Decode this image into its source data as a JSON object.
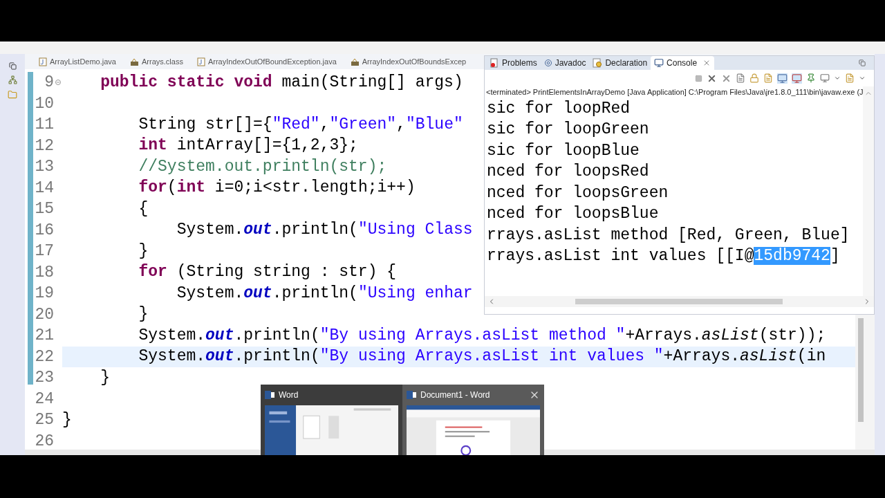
{
  "editor": {
    "tabs": [
      {
        "label": "ArrayListDemo.java",
        "kind": "java"
      },
      {
        "label": "Arrays.class",
        "kind": "class"
      },
      {
        "label": "ArrayIndexOutOfBoundException.java",
        "kind": "java"
      },
      {
        "label": "ArrayIndexOutOfBoundsExcep",
        "kind": "class"
      }
    ],
    "lines": [
      {
        "number": "9",
        "foldable": true,
        "current": false,
        "segments": [
          {
            "kind": "keyword",
            "t": "    public static void"
          },
          {
            "kind": "plain",
            "t": " main(String[] args)"
          }
        ]
      },
      {
        "number": "10",
        "foldable": false,
        "current": false
      },
      {
        "number": "11",
        "foldable": false,
        "current": false,
        "segments": [
          {
            "kind": "plain",
            "t": "        String str[]={"
          },
          {
            "kind": "string",
            "t": "\"Red\""
          },
          {
            "kind": "plain",
            "t": ","
          },
          {
            "kind": "string",
            "t": "\"Green\""
          },
          {
            "kind": "plain",
            "t": ","
          },
          {
            "kind": "string",
            "t": "\"Blue\""
          }
        ]
      },
      {
        "number": "12",
        "foldable": false,
        "current": false,
        "segments": [
          {
            "kind": "keyword",
            "t": "        int"
          },
          {
            "kind": "plain",
            "t": " intArray[]={1,2,3};"
          }
        ]
      },
      {
        "number": "13",
        "foldable": false,
        "current": false,
        "segments": [
          {
            "kind": "comment",
            "t": "        //System.out.println(str);"
          }
        ]
      },
      {
        "number": "14",
        "foldable": false,
        "current": false,
        "segments": [
          {
            "kind": "keyword",
            "t": "        for"
          },
          {
            "kind": "plain",
            "t": "("
          },
          {
            "kind": "keyword",
            "t": "int"
          },
          {
            "kind": "plain",
            "t": " i=0;i<str.length;i++)"
          }
        ]
      },
      {
        "number": "15",
        "foldable": false,
        "current": false,
        "segments": [
          {
            "kind": "plain",
            "t": "        {"
          }
        ]
      },
      {
        "number": "16",
        "foldable": false,
        "current": false,
        "segments": [
          {
            "kind": "plain",
            "t": "            System."
          },
          {
            "kind": "field",
            "t": "out"
          },
          {
            "kind": "plain",
            "t": ".println("
          },
          {
            "kind": "string",
            "t": "\"Using Class"
          }
        ]
      },
      {
        "number": "17",
        "foldable": false,
        "current": false,
        "segments": [
          {
            "kind": "plain",
            "t": "        }"
          }
        ]
      },
      {
        "number": "18",
        "foldable": false,
        "current": false,
        "segments": [
          {
            "kind": "keyword",
            "t": "        for"
          },
          {
            "kind": "plain",
            "t": " (String string : str) {"
          }
        ]
      },
      {
        "number": "19",
        "foldable": false,
        "current": false,
        "segments": [
          {
            "kind": "plain",
            "t": "            System."
          },
          {
            "kind": "field",
            "t": "out"
          },
          {
            "kind": "plain",
            "t": ".println("
          },
          {
            "kind": "string",
            "t": "\"Using enhar"
          }
        ]
      },
      {
        "number": "20",
        "foldable": false,
        "current": false,
        "segments": [
          {
            "kind": "plain",
            "t": "        }"
          }
        ]
      },
      {
        "number": "21",
        "foldable": false,
        "current": false,
        "segments": [
          {
            "kind": "plain",
            "t": "        System."
          },
          {
            "kind": "field",
            "t": "out"
          },
          {
            "kind": "plain",
            "t": ".println("
          },
          {
            "kind": "string",
            "t": "\"By using Arrays.asList method \""
          },
          {
            "kind": "plain",
            "t": "+Arrays."
          },
          {
            "kind": "static",
            "t": "asList"
          },
          {
            "kind": "plain",
            "t": "(str));"
          }
        ]
      },
      {
        "number": "22",
        "foldable": false,
        "current": true,
        "segments": [
          {
            "kind": "plain",
            "t": "        System."
          },
          {
            "kind": "field",
            "t": "out"
          },
          {
            "kind": "plain",
            "t": ".println("
          },
          {
            "kind": "string",
            "t": "\"By using Arrays.asList int values \""
          },
          {
            "kind": "plain",
            "t": "+Arrays."
          },
          {
            "kind": "static",
            "t": "asList"
          },
          {
            "kind": "plain",
            "t": "(in"
          }
        ]
      },
      {
        "number": "23",
        "foldable": false,
        "current": false,
        "segments": [
          {
            "kind": "plain",
            "t": "    }"
          }
        ]
      },
      {
        "number": "24",
        "foldable": false,
        "current": false
      },
      {
        "number": "25",
        "foldable": false,
        "current": false,
        "segments": [
          {
            "kind": "plain",
            "t": "}"
          }
        ]
      },
      {
        "number": "26",
        "foldable": false,
        "current": false
      }
    ]
  },
  "console_view": {
    "tabs": [
      {
        "label": "Problems",
        "kind": "problems",
        "selected": false,
        "closable": false
      },
      {
        "label": "Javadoc",
        "kind": "javadoc",
        "selected": false,
        "closable": false
      },
      {
        "label": "Declaration",
        "kind": "declaration",
        "selected": false,
        "closable": false
      },
      {
        "label": "Console",
        "kind": "console",
        "selected": true,
        "closable": true
      }
    ],
    "status": "<terminated> PrintElementsInArrayDemo [Java Application] C:\\Program Files\\Java\\jre1.8.0_111\\bin\\javaw.exe (J",
    "output": [
      [
        {
          "t": "sic for loopRed",
          "selected": false
        }
      ],
      [
        {
          "t": "sic for loopGreen",
          "selected": false
        }
      ],
      [
        {
          "t": "sic for loopBlue",
          "selected": false
        }
      ],
      [
        {
          "t": "nced for loopsRed",
          "selected": false
        }
      ],
      [
        {
          "t": "nced for loopsGreen",
          "selected": false
        }
      ],
      [
        {
          "t": "nced for loopsBlue",
          "selected": false
        }
      ],
      [
        {
          "t": "rrays.asList method [Red, Green, Blue]",
          "selected": false
        }
      ],
      [
        {
          "t": "rrays.asList int values [[I@",
          "selected": false
        },
        {
          "t": "15db9742",
          "selected": true
        },
        {
          "t": "]",
          "selected": false
        }
      ]
    ]
  },
  "taskbar_preview": {
    "items": [
      {
        "title": "Word",
        "selected": false
      },
      {
        "title": "Document1 - Word",
        "selected": true
      }
    ]
  }
}
